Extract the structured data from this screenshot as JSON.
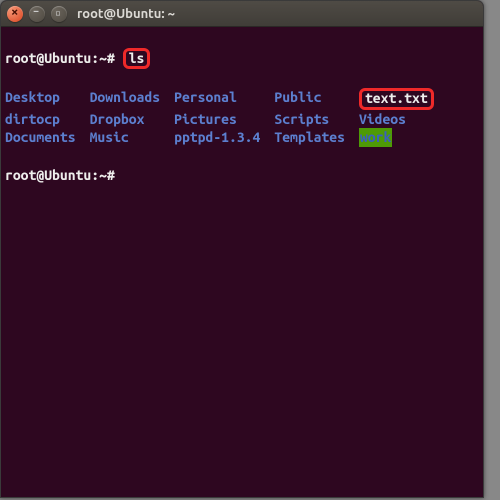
{
  "window": {
    "title": "root@Ubuntu: ~"
  },
  "prompt": {
    "user_host": "root@Ubuntu",
    "path": "~",
    "symbol": "#"
  },
  "command": "ls",
  "listing": [
    {
      "name": "Desktop",
      "kind": "dir",
      "hl": ""
    },
    {
      "name": "Downloads",
      "kind": "dir",
      "hl": ""
    },
    {
      "name": "Personal",
      "kind": "dir",
      "hl": ""
    },
    {
      "name": "Public",
      "kind": "dir",
      "hl": ""
    },
    {
      "name": "text.txt",
      "kind": "file",
      "hl": "red"
    },
    {
      "name": "dirtocp",
      "kind": "dir",
      "hl": ""
    },
    {
      "name": "Dropbox",
      "kind": "dir",
      "hl": ""
    },
    {
      "name": "Pictures",
      "kind": "dir",
      "hl": ""
    },
    {
      "name": "Scripts",
      "kind": "dir",
      "hl": ""
    },
    {
      "name": "Videos",
      "kind": "dir",
      "hl": ""
    },
    {
      "name": "Documents",
      "kind": "dir",
      "hl": ""
    },
    {
      "name": "Music",
      "kind": "dir",
      "hl": ""
    },
    {
      "name": "pptpd-1.3.4",
      "kind": "dir",
      "hl": ""
    },
    {
      "name": "Templates",
      "kind": "dir",
      "hl": ""
    },
    {
      "name": "work",
      "kind": "dir",
      "hl": "green"
    }
  ]
}
